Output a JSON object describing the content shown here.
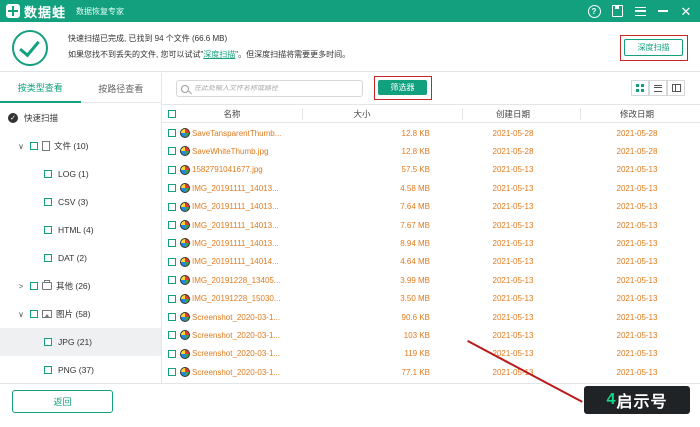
{
  "app": {
    "name": "数据蛙",
    "subtitle": "数据恢复专家"
  },
  "window_controls": [
    "help-icon",
    "save-icon",
    "menu-icon",
    "minimize-icon",
    "close-icon"
  ],
  "status": {
    "line1": "快速扫描已完成, 已找到 94 个文件 (66.6 MB)",
    "line2_prefix": "如果您找不到丢失的文件, 您可以试试\"",
    "line2_link": "深度扫描",
    "line2_suffix": "\"。但深度扫描将需要更多时间。",
    "deep_scan_button": "深度扫描"
  },
  "left": {
    "tabs": [
      "按类型查看",
      "按路径查看"
    ],
    "active_tab": 0,
    "tree": [
      {
        "label": "快速扫描",
        "level": 0,
        "arrow": "",
        "checkbox": "dark",
        "icon": ""
      },
      {
        "label": "文件 (10)",
        "level": 1,
        "arrow": "∨",
        "checkbox": "box",
        "icon": "doc"
      },
      {
        "label": "LOG (1)",
        "level": 2,
        "arrow": "",
        "checkbox": "box",
        "icon": ""
      },
      {
        "label": "CSV (3)",
        "level": 2,
        "arrow": "",
        "checkbox": "box",
        "icon": ""
      },
      {
        "label": "HTML (4)",
        "level": 2,
        "arrow": "",
        "checkbox": "box",
        "icon": ""
      },
      {
        "label": "DAT (2)",
        "level": 2,
        "arrow": "",
        "checkbox": "box",
        "icon": ""
      },
      {
        "label": "其他 (26)",
        "level": 1,
        "arrow": ">",
        "checkbox": "box",
        "icon": "folder"
      },
      {
        "label": "图片 (58)",
        "level": 1,
        "arrow": "∨",
        "checkbox": "box",
        "icon": "pic"
      },
      {
        "label": "JPG (21)",
        "level": 2,
        "arrow": "",
        "checkbox": "box",
        "icon": "",
        "selected": true
      },
      {
        "label": "PNG (37)",
        "level": 2,
        "arrow": "",
        "checkbox": "box",
        "icon": ""
      }
    ],
    "back_button": "返回"
  },
  "toolbar": {
    "search_placeholder": "在此处输入文件名称或路径",
    "filter_button": "筛选器"
  },
  "table": {
    "headers": {
      "name": "名称",
      "size": "大小",
      "created": "创建日期",
      "modified": "修改日期"
    },
    "rows": [
      {
        "name": "SaveTansparentThumb...",
        "size": "12.8 KB",
        "created": "2021-05-28",
        "modified": "2021-05-28"
      },
      {
        "name": "SaveWhiteThumb.jpg",
        "size": "12.8 KB",
        "created": "2021-05-28",
        "modified": "2021-05-28"
      },
      {
        "name": "1582791041677.jpg",
        "size": "57.5 KB",
        "created": "2021-05-13",
        "modified": "2021-05-13"
      },
      {
        "name": "IMG_20191111_14013...",
        "size": "4.58 MB",
        "created": "2021-05-13",
        "modified": "2021-05-13"
      },
      {
        "name": "IMG_20191111_14013...",
        "size": "7.64 MB",
        "created": "2021-05-13",
        "modified": "2021-05-13"
      },
      {
        "name": "IMG_20191111_14013...",
        "size": "7.67 MB",
        "created": "2021-05-13",
        "modified": "2021-05-13"
      },
      {
        "name": "IMG_20191111_14013...",
        "size": "8.94 MB",
        "created": "2021-05-13",
        "modified": "2021-05-13"
      },
      {
        "name": "IMG_20191111_14014...",
        "size": "4.64 MB",
        "created": "2021-05-13",
        "modified": "2021-05-13"
      },
      {
        "name": "IMG_20191228_13405...",
        "size": "3.99 MB",
        "created": "2021-05-13",
        "modified": "2021-05-13"
      },
      {
        "name": "IMG_20191228_15030...",
        "size": "3.50 MB",
        "created": "2021-05-13",
        "modified": "2021-05-13"
      },
      {
        "name": "Screenshot_2020-03-1...",
        "size": "90.6 KB",
        "created": "2021-05-13",
        "modified": "2021-05-13"
      },
      {
        "name": "Screenshot_2020-03-1...",
        "size": "103 KB",
        "created": "2021-05-13",
        "modified": "2021-05-13"
      },
      {
        "name": "Screenshot_2020-03-1...",
        "size": "119 KB",
        "created": "2021-05-13",
        "modified": "2021-05-13"
      },
      {
        "name": "Screenshot_2020-03-1...",
        "size": "77.1 KB",
        "created": "2021-05-13",
        "modified": "2021-05-13"
      }
    ]
  },
  "watermark": {
    "part1": "4",
    "part2": "启示号"
  },
  "colors": {
    "accent": "#12a07e",
    "highlight": "#c62828",
    "file_text": "#e07b1e"
  }
}
